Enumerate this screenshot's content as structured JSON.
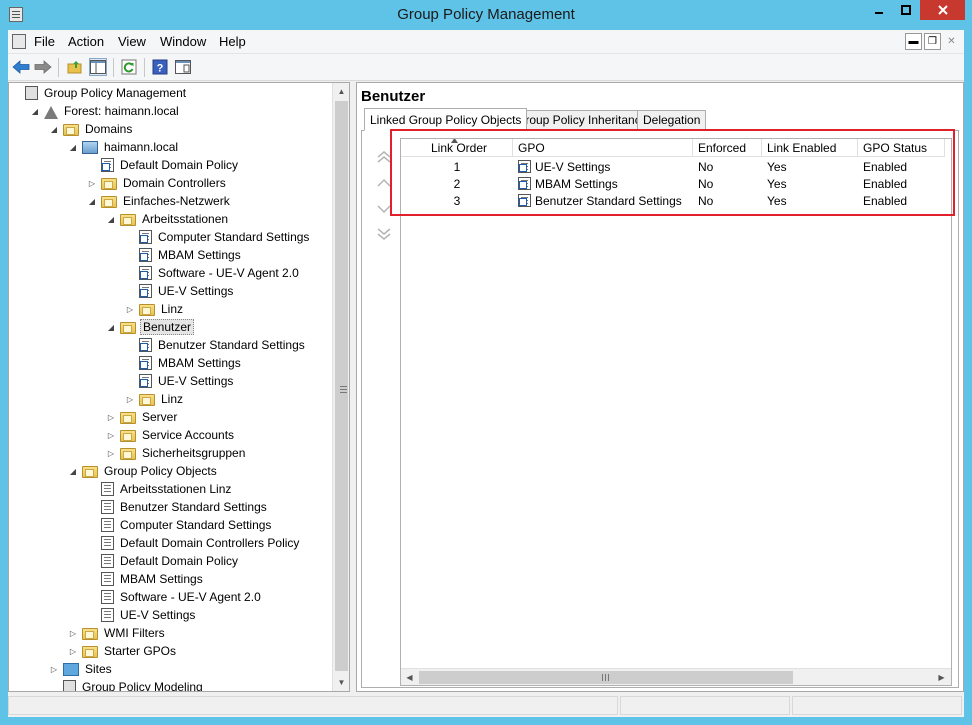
{
  "window": {
    "title": "Group Policy Management",
    "minimize_icon": "minimize-icon",
    "maximize_icon": "maximize-icon",
    "close_icon": "close-icon",
    "close_color": "#c7392f",
    "frame_color": "#5fc3e8"
  },
  "menu": {
    "items": [
      "File",
      "Action",
      "View",
      "Window",
      "Help"
    ]
  },
  "toolbar": {
    "icons": [
      "back-arrow-icon",
      "forward-arrow-icon",
      "up-folder-icon",
      "show-hide-tree-icon",
      "refresh-icon",
      "help-icon",
      "properties-icon"
    ]
  },
  "tree": {
    "items": [
      {
        "label": "Group Policy Management",
        "icon": "gpm-console-icon",
        "expander": ""
      },
      {
        "label": "Forest: haimann.local",
        "icon": "forest-icon",
        "expander": "◢"
      },
      {
        "label": "Domains",
        "icon": "domains-folder-icon",
        "expander": "◢"
      },
      {
        "label": "haimann.local",
        "icon": "domain-icon",
        "expander": "◢"
      },
      {
        "label": "Default Domain Policy",
        "icon": "gpo-link-icon",
        "expander": ""
      },
      {
        "label": "Domain Controllers",
        "icon": "ou-folder-icon",
        "expander": "▷"
      },
      {
        "label": "Einfaches-Netzwerk",
        "icon": "ou-folder-icon",
        "expander": "◢"
      },
      {
        "label": "Arbeitsstationen",
        "icon": "ou-folder-icon",
        "expander": "◢"
      },
      {
        "label": "Computer Standard Settings",
        "icon": "gpo-link-icon",
        "expander": ""
      },
      {
        "label": "MBAM Settings",
        "icon": "gpo-link-icon",
        "expander": ""
      },
      {
        "label": "Software - UE-V Agent 2.0",
        "icon": "gpo-link-icon",
        "expander": ""
      },
      {
        "label": "UE-V Settings",
        "icon": "gpo-link-icon",
        "expander": ""
      },
      {
        "label": "Linz",
        "icon": "ou-folder-icon",
        "expander": "▷"
      },
      {
        "label": "Benutzer",
        "icon": "ou-folder-icon",
        "expander": "◢",
        "selected": true
      },
      {
        "label": "Benutzer Standard Settings",
        "icon": "gpo-link-icon",
        "expander": ""
      },
      {
        "label": "MBAM Settings",
        "icon": "gpo-link-icon",
        "expander": ""
      },
      {
        "label": "UE-V Settings",
        "icon": "gpo-link-icon",
        "expander": ""
      },
      {
        "label": "Linz",
        "icon": "ou-folder-icon",
        "expander": "▷"
      },
      {
        "label": "Server",
        "icon": "ou-folder-icon",
        "expander": "▷"
      },
      {
        "label": "Service Accounts",
        "icon": "ou-folder-icon",
        "expander": "▷"
      },
      {
        "label": "Sicherheitsgruppen",
        "icon": "ou-folder-icon",
        "expander": "▷"
      },
      {
        "label": "Group Policy Objects",
        "icon": "gpo-container-folder-icon",
        "expander": "◢"
      },
      {
        "label": "Arbeitsstationen Linz",
        "icon": "gpo-icon",
        "expander": ""
      },
      {
        "label": "Benutzer Standard Settings",
        "icon": "gpo-icon",
        "expander": ""
      },
      {
        "label": "Computer Standard Settings",
        "icon": "gpo-icon",
        "expander": ""
      },
      {
        "label": "Default Domain Controllers Policy",
        "icon": "gpo-icon",
        "expander": ""
      },
      {
        "label": "Default Domain Policy",
        "icon": "gpo-icon",
        "expander": ""
      },
      {
        "label": "MBAM Settings",
        "icon": "gpo-icon",
        "expander": ""
      },
      {
        "label": "Software - UE-V Agent 2.0",
        "icon": "gpo-icon",
        "expander": ""
      },
      {
        "label": "UE-V Settings",
        "icon": "gpo-icon",
        "expander": ""
      },
      {
        "label": "WMI Filters",
        "icon": "wmi-folder-icon",
        "expander": "▷"
      },
      {
        "label": "Starter GPOs",
        "icon": "starter-gpo-folder-icon",
        "expander": "▷"
      },
      {
        "label": "Sites",
        "icon": "sites-icon",
        "expander": "▷"
      },
      {
        "label": "Group Policy Modeling",
        "icon": "modeling-icon",
        "expander": ""
      }
    ]
  },
  "details": {
    "title": "Benutzer",
    "tabs": [
      "Linked Group Policy Objects",
      "Group Policy Inheritance",
      "Delegation"
    ],
    "order_buttons": [
      "move-top-icon",
      "move-up-icon",
      "move-down-icon",
      "move-bottom-icon"
    ],
    "columns": [
      "Link Order",
      "GPO",
      "Enforced",
      "Link Enabled",
      "GPO Status"
    ],
    "rows": [
      {
        "order": "1",
        "gpo": "UE-V Settings",
        "enforced": "No",
        "link_enabled": "Yes",
        "status": "Enabled"
      },
      {
        "order": "2",
        "gpo": "MBAM Settings",
        "enforced": "No",
        "link_enabled": "Yes",
        "status": "Enabled"
      },
      {
        "order": "3",
        "gpo": "Benutzer Standard Settings",
        "enforced": "No",
        "link_enabled": "Yes",
        "status": "Enabled"
      }
    ],
    "highlight_color": "#e0202a"
  }
}
